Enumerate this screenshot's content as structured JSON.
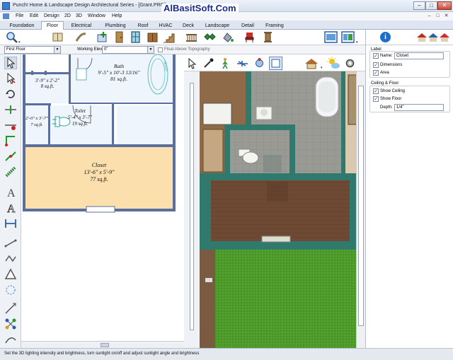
{
  "window": {
    "title": "Punch! Home & Landscape Design Architectural Series - [Grant.PRO]",
    "watermark": "AlBasitSoft.Com",
    "minimize_glyph": "–",
    "maximize_glyph": "□",
    "close_glyph": "✕"
  },
  "menu": {
    "items": [
      "File",
      "Edit",
      "Design",
      "2D",
      "3D",
      "Window",
      "Help"
    ],
    "mdi_minimize": "–",
    "mdi_restore": "□",
    "mdi_close": "✕"
  },
  "tabs": {
    "items": [
      "Foundation",
      "Floor",
      "Electrical",
      "Plumbing",
      "Roof",
      "HVAC",
      "Deck",
      "Landscape",
      "Detail",
      "Framing"
    ],
    "active": "Floor"
  },
  "options": {
    "floor": "First Floor",
    "elevation_label": "Working Elevation:",
    "elevation_value": "0\"",
    "float_label": "Float Above Topography",
    "float_checked": false
  },
  "plan": {
    "rooms": [
      {
        "name": "",
        "dims": "3'-9\" x 2'-2\"",
        "area": "8 sq.ft."
      },
      {
        "name": "Bath",
        "dims": "9'-5\" x 10'-3 13/16\"",
        "area": "81 sq.ft."
      },
      {
        "name": "",
        "dims": "2'-0\" x 3'-7\"",
        "area": "7 sq.ft."
      },
      {
        "name": "Toilet",
        "dims": "5'-4\" x 3'-7\"",
        "area": "19 sq.ft."
      },
      {
        "name": "Closet",
        "dims": "13'-6\" x 5'-9\"",
        "area": "77 sq.ft."
      }
    ],
    "shower_label": "Shower",
    "closet_fill": "#fbe0ae",
    "wall_color": "#5b6f9f"
  },
  "right_panel": {
    "label_section": "Label",
    "name_label": "Name:",
    "name_value": "Closet",
    "name_checked": true,
    "dimensions_label": "Dimensions",
    "dimensions_checked": true,
    "area_label": "Area",
    "area_checked": true,
    "ceiling_section": "Ceiling & Floor",
    "show_ceiling_label": "Show Ceiling",
    "show_ceiling_checked": true,
    "show_floor_label": "Show Floor",
    "show_floor_checked": true,
    "depth_label": "Depth:",
    "depth_value": "1/4\"",
    "check_glyph": "✓"
  },
  "status": {
    "text": "Set the 3D lighting intensity and brightness, turn sunlight on/off and adjust sunlight angle and brightness"
  },
  "colors": {
    "accent": "#1a6fd0",
    "wall_3d": "#2f7a6c",
    "grass": "#4c9a2a"
  }
}
